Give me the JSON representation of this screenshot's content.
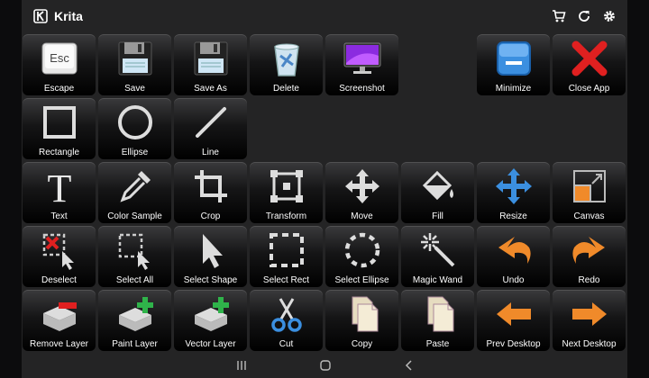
{
  "app": {
    "title": "Krita"
  },
  "topbar_icons": [
    "cart-icon",
    "refresh-icon",
    "settings-icon"
  ],
  "rows": [
    [
      {
        "key": "escape",
        "label": "Escape",
        "icon": "esc-key-icon",
        "col": 0
      },
      {
        "key": "save",
        "label": "Save",
        "icon": "floppy-icon",
        "col": 1
      },
      {
        "key": "save-as",
        "label": "Save As",
        "icon": "floppy-icon",
        "col": 2
      },
      {
        "key": "delete",
        "label": "Delete",
        "icon": "trash-icon",
        "col": 3
      },
      {
        "key": "screenshot",
        "label": "Screenshot",
        "icon": "monitor-icon",
        "col": 4
      },
      {
        "key": "minimize",
        "label": "Minimize",
        "icon": "minimize-window-icon",
        "col": 6
      },
      {
        "key": "close-app",
        "label": "Close App",
        "icon": "red-x-icon",
        "col": 7
      }
    ],
    [
      {
        "key": "rectangle",
        "label": "Rectangle",
        "icon": "square-outline-icon",
        "col": 0
      },
      {
        "key": "ellipse",
        "label": "Ellipse",
        "icon": "circle-outline-icon",
        "col": 1
      },
      {
        "key": "line",
        "label": "Line",
        "icon": "diagonal-line-icon",
        "col": 2
      }
    ],
    [
      {
        "key": "text",
        "label": "Text",
        "icon": "letter-t-icon",
        "col": 0
      },
      {
        "key": "color-sample",
        "label": "Color Sample",
        "icon": "eyedropper-icon",
        "col": 1
      },
      {
        "key": "crop",
        "label": "Crop",
        "icon": "crop-icon",
        "col": 2
      },
      {
        "key": "transform",
        "label": "Transform",
        "icon": "transform-icon",
        "col": 3
      },
      {
        "key": "move",
        "label": "Move",
        "icon": "move-arrows-icon",
        "col": 4
      },
      {
        "key": "fill",
        "label": "Fill",
        "icon": "paint-bucket-icon",
        "col": 5
      },
      {
        "key": "resize",
        "label": "Resize",
        "icon": "resize-arrows-icon",
        "col": 6
      },
      {
        "key": "canvas",
        "label": "Canvas",
        "icon": "canvas-resize-icon",
        "col": 7
      }
    ],
    [
      {
        "key": "deselect",
        "label": "Deselect",
        "icon": "deselect-icon",
        "col": 0
      },
      {
        "key": "select-all",
        "label": "Select All",
        "icon": "select-all-icon",
        "col": 1
      },
      {
        "key": "select-shape",
        "label": "Select Shape",
        "icon": "pointer-icon",
        "col": 2
      },
      {
        "key": "select-rect",
        "label": "Select Rect",
        "icon": "dashed-rect-icon",
        "col": 3
      },
      {
        "key": "select-ellipse",
        "label": "Select Ellipse",
        "icon": "dashed-circle-icon",
        "col": 4
      },
      {
        "key": "magic-wand",
        "label": "Magic Wand",
        "icon": "magic-wand-icon",
        "col": 5
      },
      {
        "key": "undo",
        "label": "Undo",
        "icon": "undo-arrow-icon",
        "col": 6
      },
      {
        "key": "redo",
        "label": "Redo",
        "icon": "redo-arrow-icon",
        "col": 7
      }
    ],
    [
      {
        "key": "remove-layer",
        "label": "Remove Layer",
        "icon": "remove-layer-icon",
        "col": 0
      },
      {
        "key": "paint-layer",
        "label": "Paint Layer",
        "icon": "add-layer-icon",
        "col": 1
      },
      {
        "key": "vector-layer",
        "label": "Vector Layer",
        "icon": "add-layer-icon",
        "col": 2
      },
      {
        "key": "cut",
        "label": "Cut",
        "icon": "scissors-icon",
        "col": 3
      },
      {
        "key": "copy",
        "label": "Copy",
        "icon": "documents-icon",
        "col": 4
      },
      {
        "key": "paste",
        "label": "Paste",
        "icon": "documents-icon",
        "col": 5
      },
      {
        "key": "prev-desktop",
        "label": "Prev Desktop",
        "icon": "left-arrow-icon",
        "col": 6
      },
      {
        "key": "next-desktop",
        "label": "Next Desktop",
        "icon": "right-arrow-icon",
        "col": 7
      }
    ]
  ],
  "navbar_icons": [
    "recents-icon",
    "home-icon",
    "back-icon"
  ],
  "colors": {
    "panel": "#242425",
    "orange": "#f08a2a",
    "green": "#2fb34a",
    "red": "#e02020",
    "blue": "#3b8fe0"
  }
}
